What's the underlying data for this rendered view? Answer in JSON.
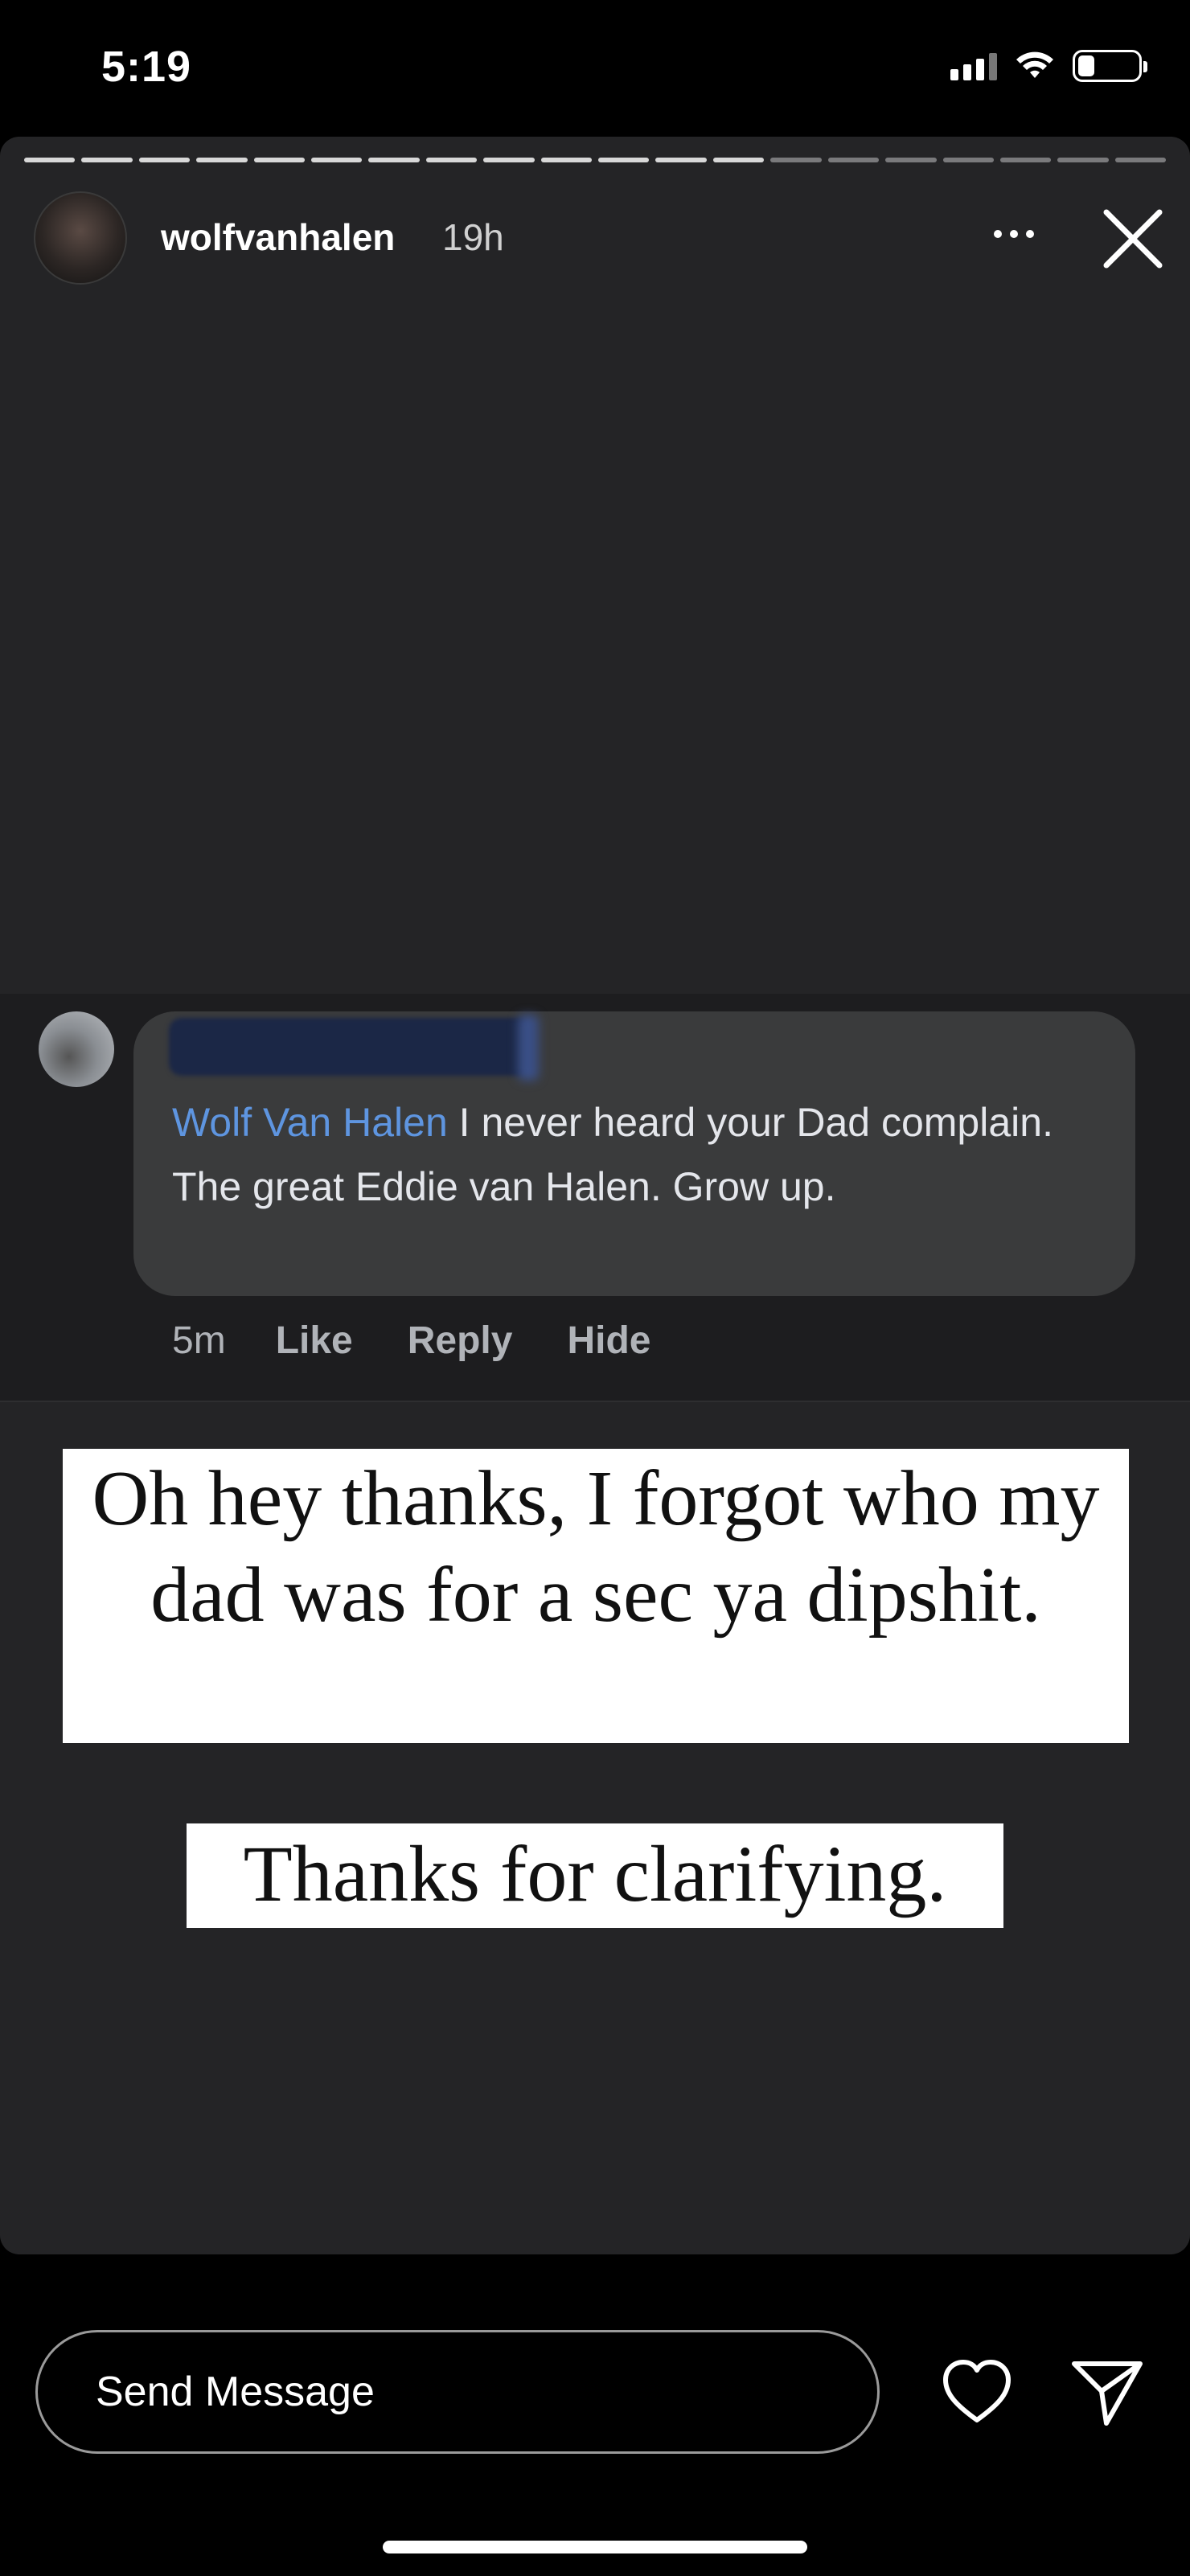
{
  "status_bar": {
    "time": "5:19",
    "icons": [
      "signal-icon",
      "wifi-icon",
      "battery-icon"
    ]
  },
  "story": {
    "username": "wolfvanhalen",
    "time_ago": "19h",
    "segments_total": 20,
    "segments_viewed": 13,
    "icons": [
      "more-icon",
      "close-icon"
    ]
  },
  "comment": {
    "mention": "Wolf Van Halen",
    "text": " I never heard your Dad complain. The great Eddie van Halen. Grow up.",
    "time": "5m",
    "actions": [
      "Like",
      "Reply",
      "Hide"
    ]
  },
  "stickers": {
    "text1": "Oh hey thanks, I forgot who my dad was for a sec ya dipshit.",
    "text2": "Thanks for clarifying."
  },
  "bottom_bar": {
    "placeholder": "Send Message",
    "icons": [
      "heart-icon",
      "send-icon"
    ]
  },
  "colors": {
    "background": "#000000",
    "story_bg": "#242426",
    "mention": "#5e95e0",
    "bubble": "#3a3b3c"
  }
}
